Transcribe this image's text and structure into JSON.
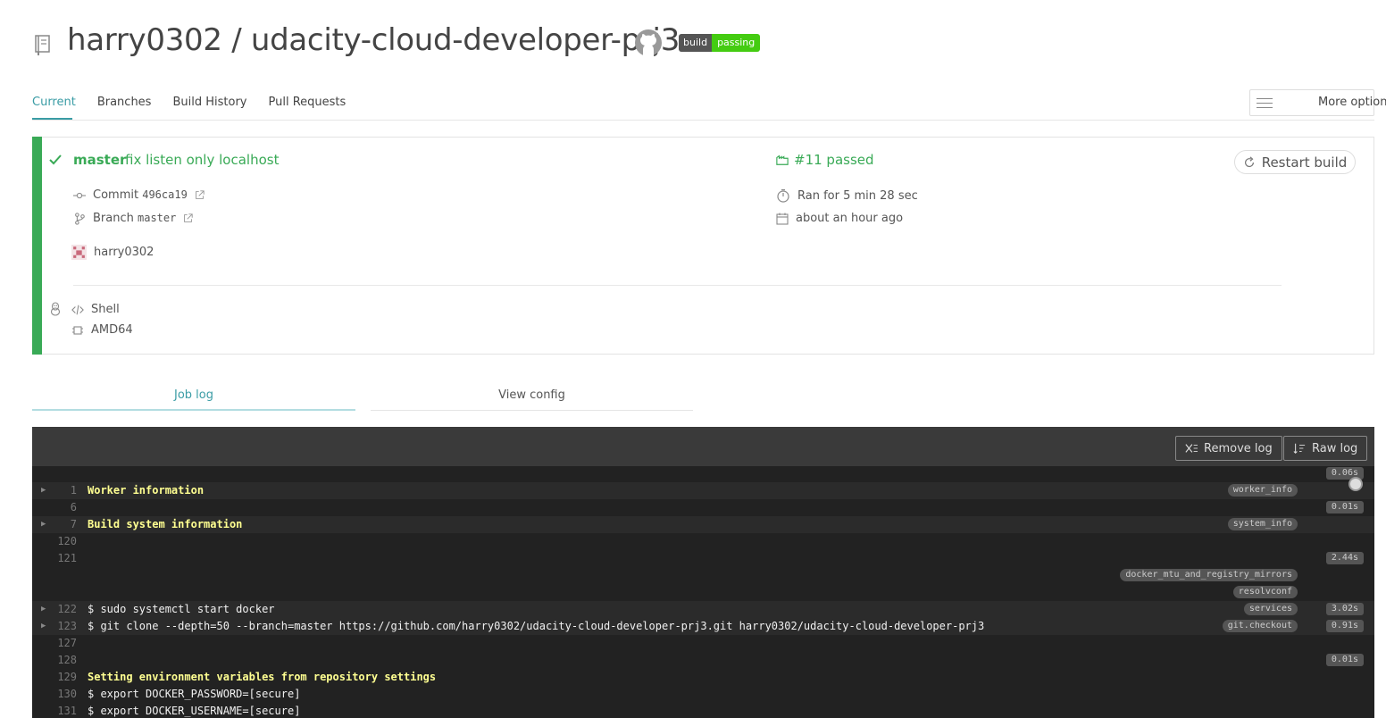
{
  "header": {
    "title": "harry0302 / udacity-cloud-developer-prj3",
    "badge_label": "build",
    "badge_status": "passing",
    "badge_color": "#44cc11"
  },
  "tabs": [
    {
      "label": "Current",
      "active": true
    },
    {
      "label": "Branches",
      "active": false
    },
    {
      "label": "Build History",
      "active": false
    },
    {
      "label": "Pull Requests",
      "active": false
    }
  ],
  "more_options": "More options",
  "build": {
    "status_color": "#39aa56",
    "branch": "master",
    "commit_message": "fix listen only localhost",
    "build_status": "#11 passed",
    "restart": "Restart build",
    "commit_label": "Commit",
    "commit_sha": "496ca19",
    "branch_label": "Branch",
    "branch_value": "master",
    "author": "harry0302",
    "ran_for": "Ran for 5 min 28 sec",
    "finished": "about an hour ago",
    "language": "Shell",
    "arch": "AMD64"
  },
  "log_tabs": {
    "job_log": "Job log",
    "view_config": "View config"
  },
  "log": {
    "remove_log": "Remove log",
    "raw_log": "Raw log",
    "rows": [
      {
        "ln": "",
        "text": "",
        "tag": "",
        "dur": "0.06s",
        "fold": false,
        "yellow": false,
        "arrow": false
      },
      {
        "ln": "1",
        "text": "Worker information",
        "tag": "worker_info",
        "dur": "",
        "fold": true,
        "yellow": true,
        "arrow": true
      },
      {
        "ln": "6",
        "text": "",
        "tag": "",
        "dur": "0.01s",
        "fold": false,
        "yellow": false,
        "arrow": false
      },
      {
        "ln": "7",
        "text": "Build system information",
        "tag": "system_info",
        "dur": "",
        "fold": true,
        "yellow": true,
        "arrow": true
      },
      {
        "ln": "120",
        "text": "",
        "tag": "",
        "dur": "",
        "fold": false,
        "yellow": false,
        "arrow": false
      },
      {
        "ln": "121",
        "text": "",
        "tag": "",
        "dur": "2.44s",
        "fold": false,
        "yellow": false,
        "arrow": false
      },
      {
        "ln": "",
        "text": "",
        "tag": "docker_mtu_and_registry_mirrors",
        "dur": "",
        "fold": false,
        "yellow": false,
        "arrow": false
      },
      {
        "ln": "",
        "text": "",
        "tag": "resolvconf",
        "dur": "",
        "fold": false,
        "yellow": false,
        "arrow": false
      },
      {
        "ln": "122",
        "text": "$ sudo systemctl start docker",
        "tag": "services",
        "dur": "3.02s",
        "fold": true,
        "yellow": false,
        "arrow": true
      },
      {
        "ln": "123",
        "text": "$ git clone --depth=50 --branch=master https://github.com/harry0302/udacity-cloud-developer-prj3.git harry0302/udacity-cloud-developer-prj3",
        "tag": "git.checkout",
        "dur": "0.91s",
        "fold": true,
        "yellow": false,
        "arrow": true
      },
      {
        "ln": "127",
        "text": "",
        "tag": "",
        "dur": "",
        "fold": false,
        "yellow": false,
        "arrow": false
      },
      {
        "ln": "128",
        "text": "",
        "tag": "",
        "dur": "0.01s",
        "fold": false,
        "yellow": false,
        "arrow": false
      },
      {
        "ln": "129",
        "text": "Setting environment variables from repository settings",
        "tag": "",
        "dur": "",
        "fold": false,
        "yellow": true,
        "arrow": false
      },
      {
        "ln": "130",
        "text": "$ export DOCKER_PASSWORD=[secure]",
        "tag": "",
        "dur": "",
        "fold": false,
        "yellow": false,
        "arrow": false
      },
      {
        "ln": "131",
        "text": "$ export DOCKER_USERNAME=[secure]",
        "tag": "",
        "dur": "",
        "fold": false,
        "yellow": false,
        "arrow": false
      }
    ]
  }
}
